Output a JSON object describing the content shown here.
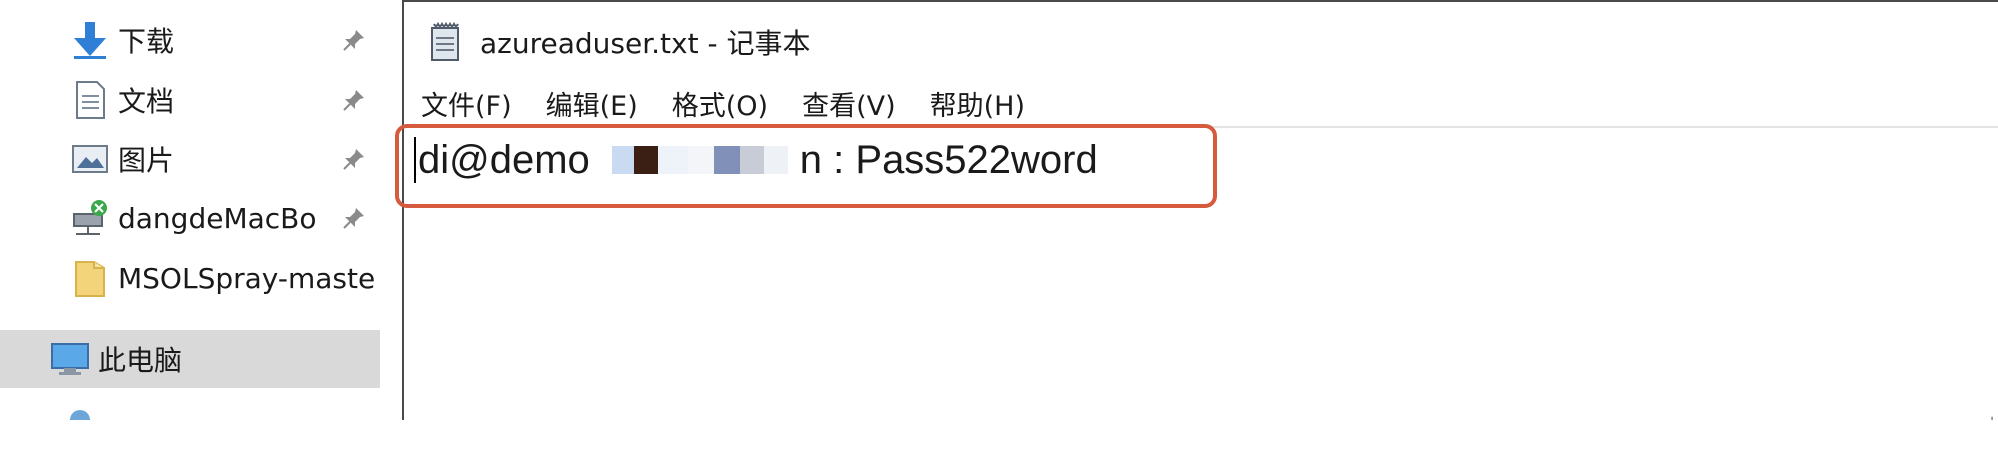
{
  "nav": {
    "items": [
      {
        "label": "下载",
        "icon": "download-arrow-icon",
        "pinned": true
      },
      {
        "label": "文档",
        "icon": "document-icon",
        "pinned": true
      },
      {
        "label": "图片",
        "icon": "pictures-icon",
        "pinned": true
      },
      {
        "label": "dangdeMacBo",
        "icon": "network-drive-icon",
        "pinned": true
      },
      {
        "label": "MSOLSpray-maste",
        "icon": "folder-icon",
        "pinned": false
      }
    ],
    "this_pc": {
      "label": "此电脑",
      "icon": "computer-icon",
      "selected": true
    }
  },
  "notepad": {
    "title": "azureaduser.txt - 记事本",
    "menu": [
      "文件(F)",
      "编辑(E)",
      "格式(O)",
      "查看(V)",
      "帮助(H)"
    ],
    "content": {
      "prefix": "di@demo",
      "suffix": "n : Pass522word"
    }
  },
  "colors": {
    "highlight_box": "#d65a3e",
    "selected_nav_bg": "#d9d9d9",
    "download_icon": "#2f7fd6",
    "folder_icon": "#f3d47a"
  }
}
